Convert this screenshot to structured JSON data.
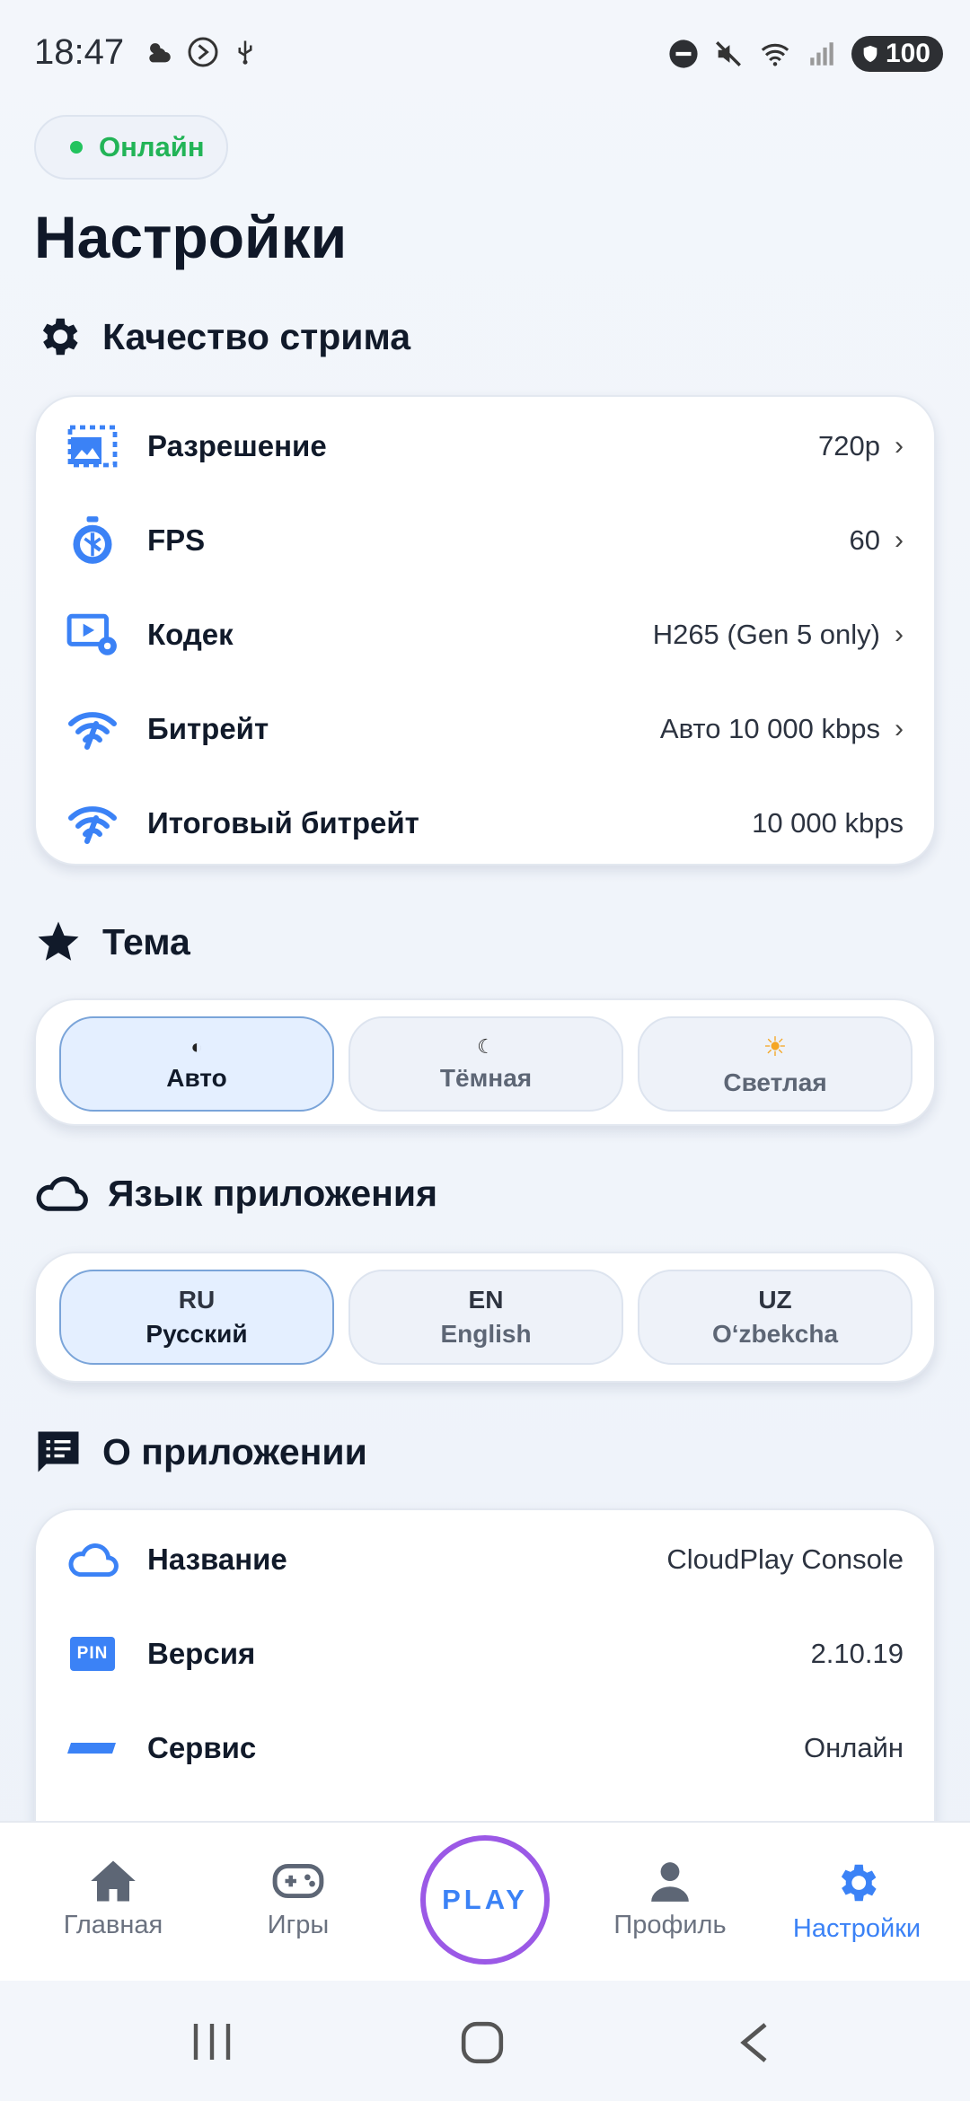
{
  "status_bar": {
    "time": "18:47",
    "battery": "100"
  },
  "connection": {
    "label": "Онлайн"
  },
  "page": {
    "title": "Настройки"
  },
  "stream_quality": {
    "title": "Качество стрима",
    "rows": [
      {
        "label": "Разрешение",
        "value": "720p",
        "icon": "image-resize-icon"
      },
      {
        "label": "FPS",
        "value": "60",
        "icon": "stopwatch-icon"
      },
      {
        "label": "Кодек",
        "value": "H265 (Gen 5 only)",
        "icon": "video-settings-icon"
      },
      {
        "label": "Битрейт",
        "value": "Авто 10 000 kbps",
        "icon": "wifi-icon"
      },
      {
        "label": "Итоговый битрейт",
        "value": "10 000 kbps",
        "icon": "wifi-icon"
      }
    ],
    "chevron": "›"
  },
  "theme": {
    "title": "Тема",
    "options": [
      {
        "symbol": "◐",
        "label": "Авто",
        "active": true
      },
      {
        "symbol": "☾",
        "label": "Тёмная",
        "active": false
      },
      {
        "symbol": "☀",
        "label": "Светлая",
        "active": false
      }
    ]
  },
  "language": {
    "title": "Язык приложения",
    "options": [
      {
        "code": "RU",
        "label": "Русский",
        "active": true
      },
      {
        "code": "EN",
        "label": "English",
        "active": false
      },
      {
        "code": "UZ",
        "label": "O‘zbekcha",
        "active": false
      }
    ]
  },
  "about": {
    "title": "О приложении",
    "rows": [
      {
        "label": "Название",
        "value": "CloudPlay Console",
        "icon": "cloud-icon"
      },
      {
        "label": "Версия",
        "value": "2.10.19",
        "icon": "pin-icon",
        "icon_text": "PIN"
      },
      {
        "label": "Сервис",
        "value": "Онлайн",
        "icon": "dash-icon"
      }
    ]
  },
  "bottom_nav": {
    "home": "Главная",
    "games": "Игры",
    "play": "PLAY",
    "profile": "Профиль",
    "settings": "Настройки"
  },
  "colors": {
    "accent": "#3b82f6",
    "online": "#22c35e",
    "play_ring": "#9b59e6"
  }
}
